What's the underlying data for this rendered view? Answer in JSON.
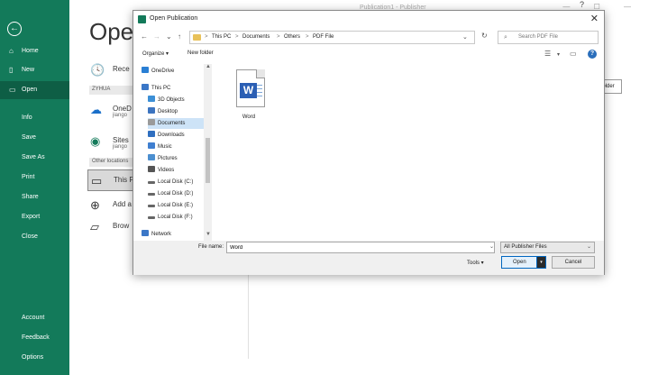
{
  "app": {
    "title": "Publication1 - Publisher",
    "help_glyph": "?",
    "window_controls": "— ☐ —"
  },
  "backstage": {
    "back_glyph": "←",
    "nav": [
      {
        "label": "Home",
        "icon": "home-icon",
        "glyph": "⌂"
      },
      {
        "label": "New",
        "icon": "new-file-icon",
        "glyph": "▯"
      },
      {
        "label": "Open",
        "icon": "open-folder-icon",
        "glyph": "▭"
      },
      {
        "label": "Info"
      },
      {
        "label": "Save"
      },
      {
        "label": "Save As"
      },
      {
        "label": "Print"
      },
      {
        "label": "Share"
      },
      {
        "label": "Export"
      },
      {
        "label": "Close"
      }
    ],
    "nav_bottom": [
      {
        "label": "Account"
      },
      {
        "label": "Feedback"
      },
      {
        "label": "Options"
      }
    ],
    "heading": "Open",
    "locations": {
      "recent": "Rece",
      "section_personal": "ZYHUA",
      "onedrive": "OneD",
      "onedrive_sub": "jiango",
      "sites": "Sites",
      "sites_sub": "jiango",
      "section_other": "Other locations",
      "this_pc": "This P",
      "add_place": "Add a",
      "browse": "Brow"
    },
    "folder_button": "older"
  },
  "dialog": {
    "title": "Open Publication",
    "close_glyph": "✕",
    "address": {
      "crumbs": [
        "This PC",
        "Documents",
        "Others",
        "PDF File"
      ],
      "separator": ">"
    },
    "search_placeholder": "Search PDF File",
    "toolbar": {
      "organize": "Organize ▾",
      "new_folder": "New folder"
    },
    "tree": [
      {
        "label": "OneDrive",
        "color": "#2a7fd4"
      },
      {
        "label": "This PC",
        "color": "#3b77c7"
      },
      {
        "label": "3D Objects",
        "color": "#3c8fd6"
      },
      {
        "label": "Desktop",
        "color": "#3c74c0"
      },
      {
        "label": "Documents",
        "color": "#9a9a9a"
      },
      {
        "label": "Downloads",
        "color": "#2f6fc0"
      },
      {
        "label": "Music",
        "color": "#3f7fd0"
      },
      {
        "label": "Pictures",
        "color": "#4c8fd0"
      },
      {
        "label": "Videos",
        "color": "#555555"
      },
      {
        "label": "Local Disk (C:)",
        "color": "#666666"
      },
      {
        "label": "Local Disk (D:)",
        "color": "#666666"
      },
      {
        "label": "Local Disk (E:)",
        "color": "#666666"
      },
      {
        "label": "Local Disk (F:)",
        "color": "#666666"
      },
      {
        "label": "Network",
        "color": "#3b77c7"
      }
    ],
    "selected_tree_item": "Documents",
    "file": {
      "name": "Word",
      "badge": "W"
    },
    "file_name_label": "File name:",
    "file_name_value": "Word",
    "file_type": "All Publisher Files",
    "tools_label": "Tools ▾",
    "open_label": "Open",
    "cancel_label": "Cancel"
  },
  "colors": {
    "sidebar": "#137a5a",
    "sidebar_active": "#0e5e45",
    "folder": "#e8c15a",
    "accent": "#0067c0",
    "word_blue": "#2b5fb4"
  }
}
